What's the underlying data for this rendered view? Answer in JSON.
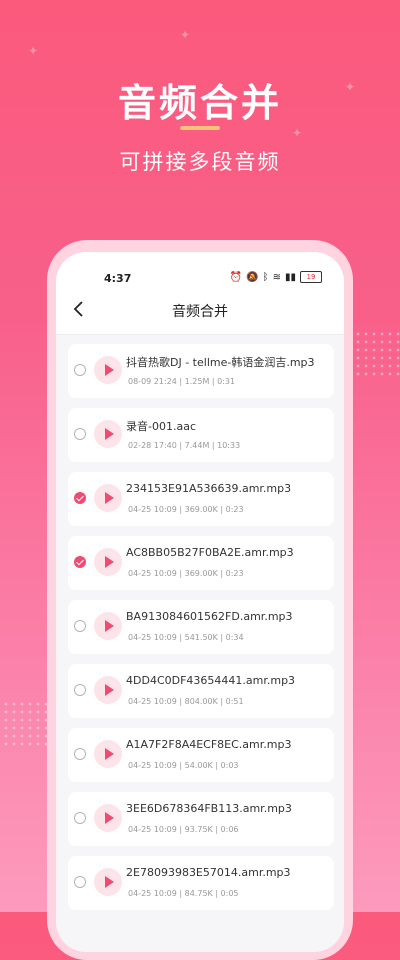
{
  "promo": {
    "title": "音频合并",
    "subtitle": "可拼接多段音频"
  },
  "status_bar": {
    "time": "4:37",
    "battery": "19"
  },
  "navbar": {
    "title": "音频合并"
  },
  "files": [
    {
      "name": "抖音热歌DJ - tellme-韩语金润吉.mp3",
      "meta": "08-09 21:24 | 1.25M | 0:31",
      "checked": false
    },
    {
      "name": "录音-001.aac",
      "meta": "02-28 17:40 | 7.44M | 10:33",
      "checked": false
    },
    {
      "name": "234153E91A536639.amr.mp3",
      "meta": "04-25 10:09 | 369.00K | 0:23",
      "checked": true
    },
    {
      "name": "AC8BB05B27F0BA2E.amr.mp3",
      "meta": "04-25 10:09 | 369.00K | 0:23",
      "checked": true
    },
    {
      "name": "BA913084601562FD.amr.mp3",
      "meta": "04-25 10:09 | 541.50K | 0:34",
      "checked": false
    },
    {
      "name": "4DD4C0DF43654441.amr.mp3",
      "meta": "04-25 10:09 | 804.00K | 0:51",
      "checked": false
    },
    {
      "name": "A1A7F2F8A4ECF8EC.amr.mp3",
      "meta": "04-25 10:09 | 54.00K | 0:03",
      "checked": false
    },
    {
      "name": "3EE6D678364FB113.amr.mp3",
      "meta": "04-25 10:09 | 93.75K | 0:06",
      "checked": false
    },
    {
      "name": "2E78093983E57014.amr.mp3",
      "meta": "04-25 10:09 | 84.75K | 0:05",
      "checked": false
    }
  ],
  "colors": {
    "accent": "#f04b73",
    "background_top": "#fb5a7d",
    "background_bottom": "#fc9bbd",
    "underline": "#f7c27b"
  }
}
